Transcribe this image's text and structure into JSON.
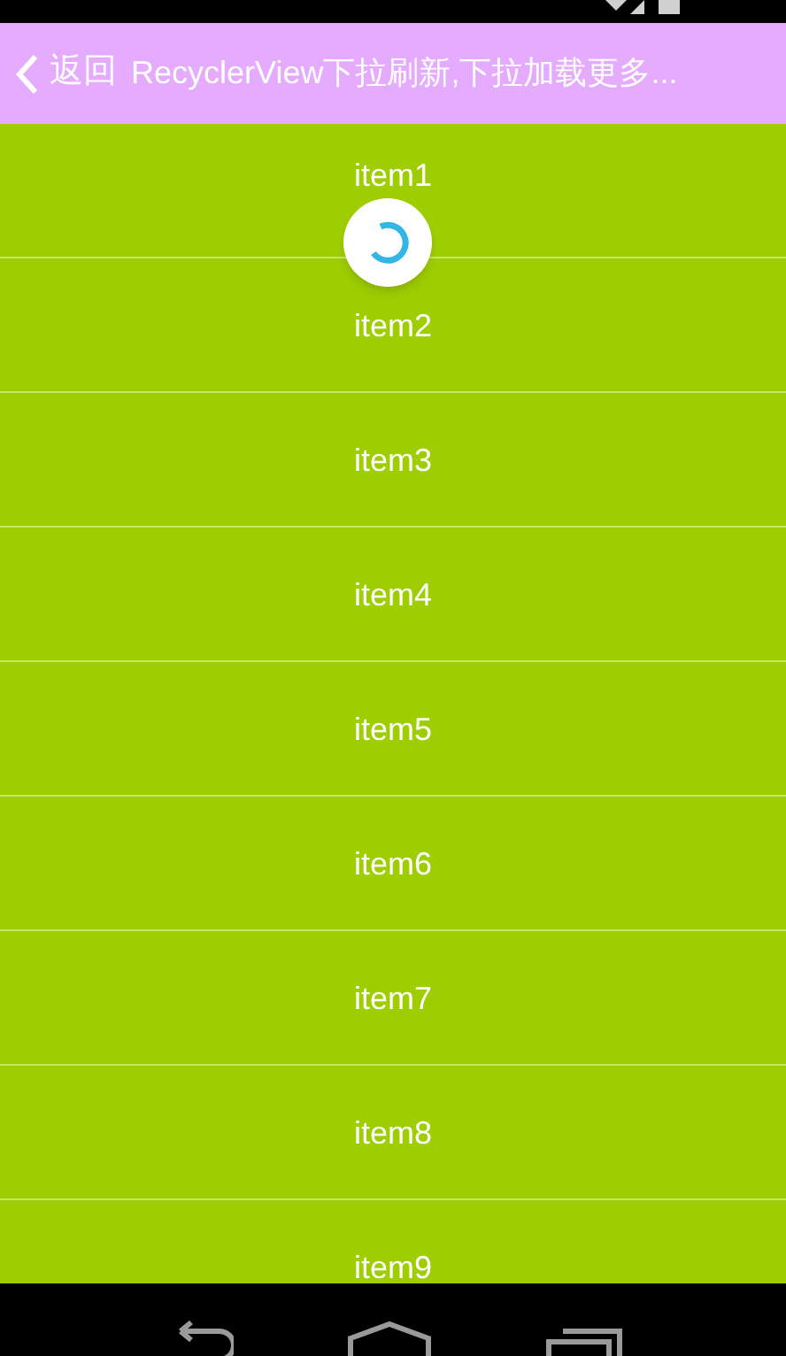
{
  "title_bar": {
    "back_label": "返回",
    "title": "RecyclerView下拉刷新,下拉加载更多..."
  },
  "refresh_indicator": {
    "refreshing": true
  },
  "items": [
    "item1",
    "item2",
    "item3",
    "item4",
    "item5",
    "item6",
    "item7",
    "item8",
    "item9"
  ]
}
